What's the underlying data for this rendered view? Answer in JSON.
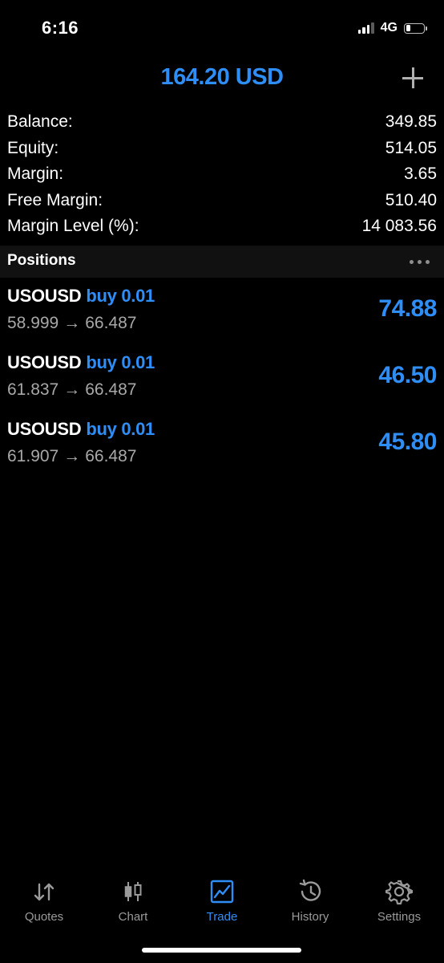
{
  "status_bar": {
    "time": "6:16",
    "network": "4G"
  },
  "header": {
    "title": "164.20 USD",
    "add_icon": "plus-icon"
  },
  "summary": [
    {
      "label": "Balance:",
      "value": "349.85"
    },
    {
      "label": "Equity:",
      "value": "514.05"
    },
    {
      "label": "Margin:",
      "value": "3.65"
    },
    {
      "label": "Free Margin:",
      "value": "510.40"
    },
    {
      "label": "Margin Level (%):",
      "value": "14 083.56"
    }
  ],
  "positions": {
    "title": "Positions",
    "items": [
      {
        "symbol": "USOUSD",
        "direction": "buy 0.01",
        "open_price": "58.999",
        "arrow": "→",
        "current_price": "66.487",
        "profit": "74.88"
      },
      {
        "symbol": "USOUSD",
        "direction": "buy 0.01",
        "open_price": "61.837",
        "arrow": "→",
        "current_price": "66.487",
        "profit": "46.50"
      },
      {
        "symbol": "USOUSD",
        "direction": "buy 0.01",
        "open_price": "61.907",
        "arrow": "→",
        "current_price": "66.487",
        "profit": "45.80"
      }
    ]
  },
  "tabbar": {
    "tabs": [
      {
        "label": "Quotes",
        "icon": "arrows-updown-icon",
        "active": false
      },
      {
        "label": "Chart",
        "icon": "candlestick-icon",
        "active": false
      },
      {
        "label": "Trade",
        "icon": "trade-chart-icon",
        "active": true
      },
      {
        "label": "History",
        "icon": "history-icon",
        "active": false
      },
      {
        "label": "Settings",
        "icon": "gear-icon",
        "active": false
      }
    ]
  },
  "colors": {
    "accent": "#2f8ef5",
    "background": "#000000",
    "section_bg": "#111111",
    "muted_text": "#a8a8a8"
  }
}
